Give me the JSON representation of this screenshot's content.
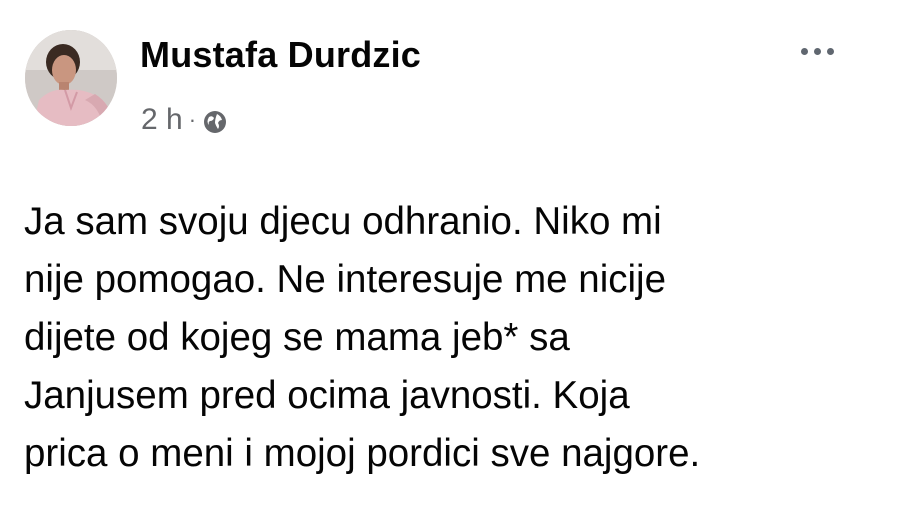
{
  "post": {
    "author": "Mustafa Durdzic",
    "time": "2 h",
    "separator": "·",
    "audience_icon": "globe-icon",
    "menu_icon": "more-options-icon",
    "text_lines": [
      "Ja sam svoju djecu odhranio. Niko mi",
      "nije pomogao. Ne interesuje me nicije",
      "dijete od kojeg se mama jeb* sa",
      "Janjusem pred ocima javnosti. Koja",
      "prica o meni i mojoj pordici sve najgore."
    ]
  },
  "colors": {
    "text": "#050505",
    "secondary": "#65676b",
    "background": "#ffffff"
  }
}
